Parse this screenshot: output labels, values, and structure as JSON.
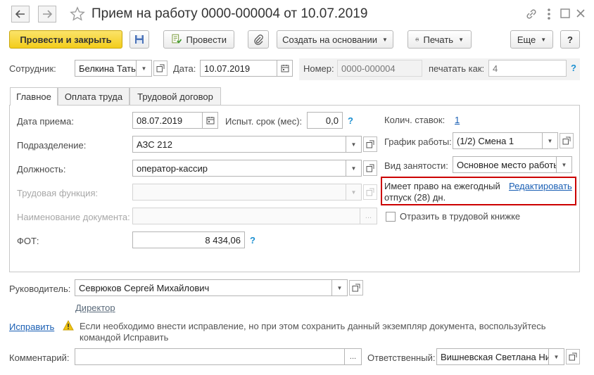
{
  "window": {
    "title": "Прием на работу 0000-000004 от 10.07.2019",
    "back_icon": "arrow-left-icon",
    "forward_icon": "arrow-right-icon",
    "favorite_icon": "star-icon",
    "link_icon": "link-icon",
    "menu_icon": "more-vertical-icon",
    "maximize_icon": "maximize-icon",
    "close_icon": "close-icon"
  },
  "toolbar": {
    "post_close_label": "Провести и закрыть",
    "post_label": "Провести",
    "create_based_label": "Создать на основании",
    "print_label": "Печать",
    "more_label": "Еще",
    "help_label": "?"
  },
  "header": {
    "employee_label": "Сотрудник:",
    "employee_value": "Белкина Татьяна",
    "date_label": "Дата:",
    "date_value": "10.07.2019",
    "number_label": "Номер:",
    "number_value": "0000-000004",
    "print_as_label": "печатать как:",
    "print_as_placeholder": "4"
  },
  "tabs": [
    {
      "label": "Главное",
      "active": true
    },
    {
      "label": "Оплата труда",
      "active": false
    },
    {
      "label": "Трудовой договор",
      "active": false
    }
  ],
  "main": {
    "hire_date_label": "Дата приема:",
    "hire_date_value": "08.07.2019",
    "probation_label": "Испыт. срок (мес):",
    "probation_value": "0,0",
    "department_label": "Подразделение:",
    "department_value": "АЗС 212",
    "position_label": "Должность:",
    "position_value": "оператор-кассир",
    "labor_function_label": "Трудовая функция:",
    "labor_function_value": "",
    "doc_name_label": "Наименование документа:",
    "doc_name_value": "",
    "fot_label": "ФОТ:",
    "fot_value": "8 434,06",
    "rates_label": "Колич. ставок:",
    "rates_value": "1",
    "schedule_label": "График работы:",
    "schedule_value": "(1/2) Смена 1",
    "employment_type_label": "Вид занятости:",
    "employment_type_value": "Основное место работы",
    "vacation_text_line1": "Имеет право на ежегодный",
    "vacation_text_line2": "отпуск (28) дн.",
    "vacation_edit_link": "Редактировать",
    "workbook_label": "Отразить в трудовой книжке",
    "highlight_color": "#cc0000"
  },
  "footer": {
    "manager_label": "Руководитель:",
    "manager_value": "Севрюков Сергей Михайлович",
    "manager_position": "Директор",
    "fix_link": "Исправить",
    "warning_line1": "Если необходимо внести исправление, но при этом сохранить данный экземпляр документа, воспользуйтесь",
    "warning_line2": "командой Исправить",
    "comment_label": "Комментарий:",
    "comment_value": "",
    "responsible_label": "Ответственный:",
    "responsible_value": "Вишневская Светлана Николаевна"
  },
  "colors": {
    "accent_yellow": "#f3cd1b",
    "link_blue": "#1a5fb4",
    "help_blue": "#1a8fd1",
    "warning_yellow": "#f1c40f"
  }
}
